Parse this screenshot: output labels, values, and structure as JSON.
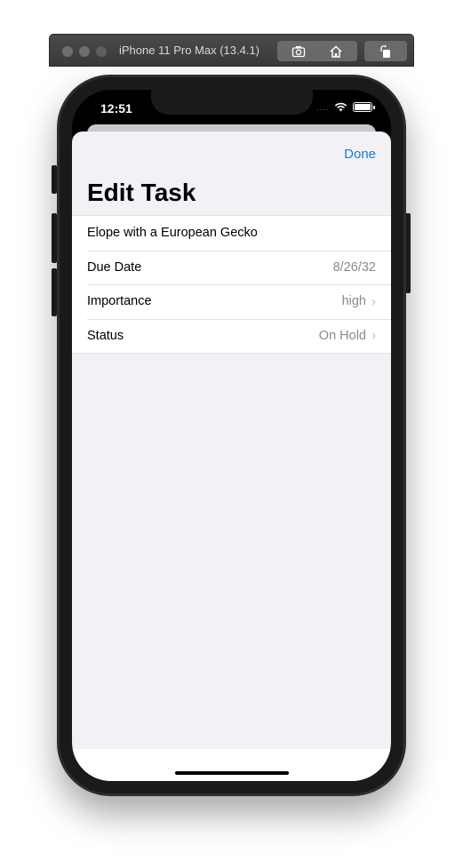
{
  "simulator": {
    "title": "iPhone 11 Pro Max (13.4.1)",
    "buttons": [
      "screenshot-icon",
      "home-icon",
      "rotate-icon"
    ]
  },
  "status_bar": {
    "time": "12:51",
    "signal": "....",
    "icons": [
      "wifi-icon",
      "battery-icon"
    ]
  },
  "sheet": {
    "done_label": "Done",
    "title": "Edit Task",
    "task_name": "Elope with a European Gecko",
    "rows": [
      {
        "label": "Due Date",
        "value": "8/26/32",
        "chevron": false
      },
      {
        "label": "Importance",
        "value": "high",
        "chevron": true
      },
      {
        "label": "Status",
        "value": "On Hold",
        "chevron": true
      }
    ]
  },
  "colors": {
    "accent": "#1a7ad4",
    "background": "#f1f1f6",
    "secondary_text": "#8a8a8e"
  }
}
